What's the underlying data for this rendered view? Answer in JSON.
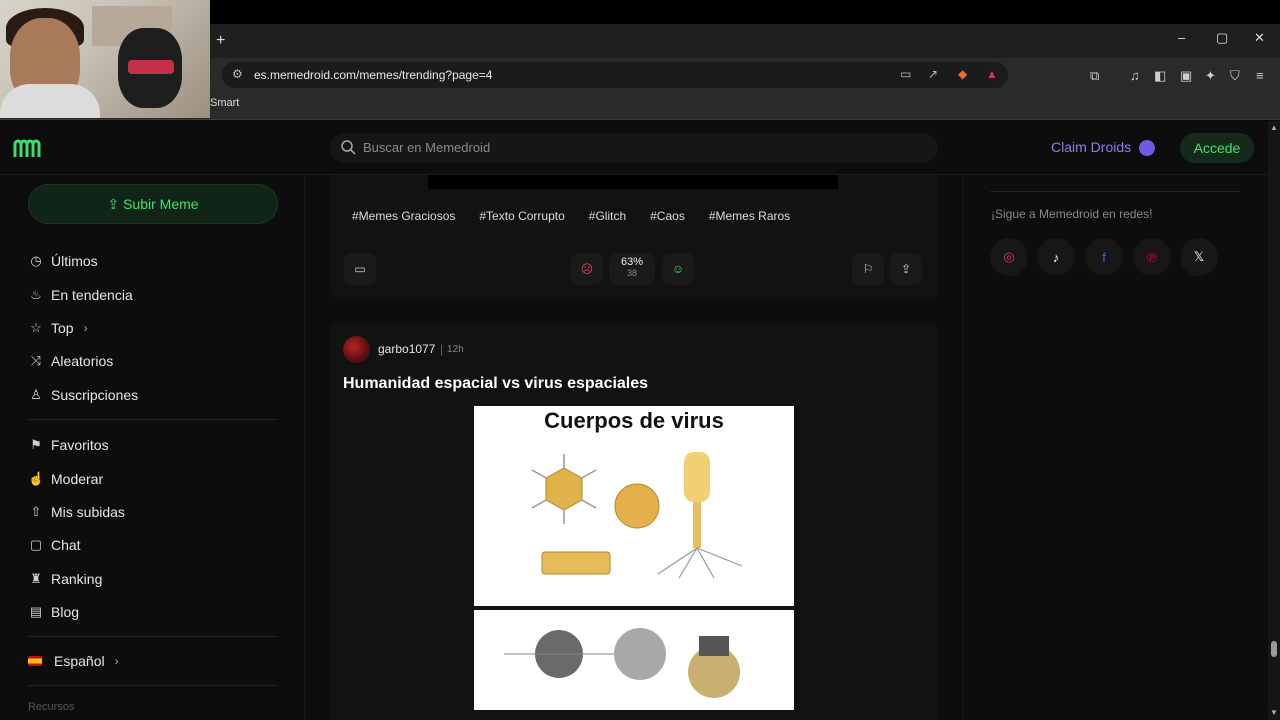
{
  "webcam": {},
  "browser": {
    "new_tab": "+",
    "url": "es.memedroid.com/memes/trending?page=4",
    "bookmark": "Smart",
    "window_controls": [
      "–",
      "▢",
      "✕"
    ]
  },
  "header": {
    "search_placeholder": "Buscar en Memedroid",
    "claim_label": "Claim Droids",
    "login_label": "Accede",
    "accent": "#3ee06d",
    "claim_color": "#8e7cf0"
  },
  "sidebar": {
    "upload_label": "Subir Meme",
    "items": [
      {
        "label": "Últimos",
        "icon": "clock-icon"
      },
      {
        "label": "En tendencia",
        "icon": "flame-icon"
      },
      {
        "label": "Top",
        "icon": "star-icon"
      },
      {
        "label": "Aleatorios",
        "icon": "shuffle-icon"
      },
      {
        "label": "Suscripciones",
        "icon": "user-icon"
      },
      {
        "label": "Favoritos",
        "icon": "bookmark-icon"
      },
      {
        "label": "Moderar",
        "icon": "thumbs-up-icon"
      },
      {
        "label": "Mis subidas",
        "icon": "upload-icon"
      },
      {
        "label": "Chat",
        "icon": "chat-icon"
      },
      {
        "label": "Ranking",
        "icon": "ranking-icon"
      },
      {
        "label": "Blog",
        "icon": "blog-icon"
      }
    ],
    "language": "Español",
    "cut_text": "Recursos"
  },
  "post1": {
    "tags": [
      "#Memes Graciosos",
      "#Texto Corrupto",
      "#Glitch",
      "#Caos",
      "#Memes Raros"
    ],
    "rating_percent": "63%",
    "rating_count": "38"
  },
  "post2": {
    "author": "garbo1077",
    "separator": "|",
    "time": "12h",
    "title": "Humanidad espacial vs virus espaciales",
    "image_text": "Cuerpos de virus"
  },
  "rightcol": {
    "follow_text": "¡Sigue a Memedroid en redes!",
    "socials": [
      "instagram-icon",
      "tiktok-icon",
      "facebook-icon",
      "pinterest-icon",
      "x-icon"
    ]
  }
}
